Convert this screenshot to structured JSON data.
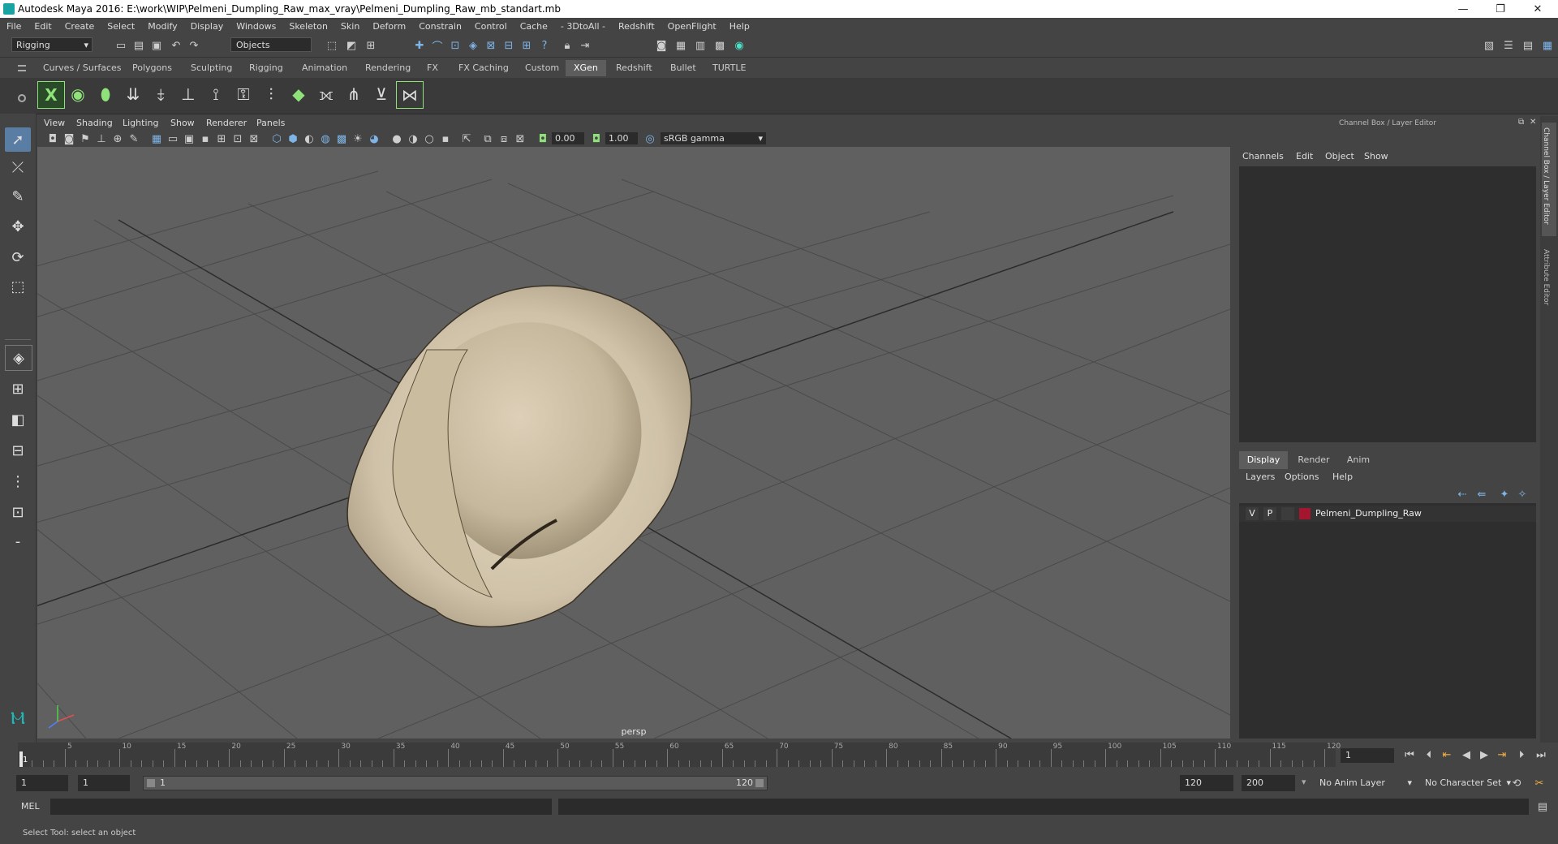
{
  "window": {
    "title": "Autodesk Maya 2016: E:\\work\\WIP\\Pelmeni_Dumpling_Raw_max_vray\\Pelmeni_Dumpling_Raw_mb_standart.mb",
    "minimize": "—",
    "restore": "❐",
    "close": "✕"
  },
  "menus": [
    "File",
    "Edit",
    "Create",
    "Select",
    "Modify",
    "Display",
    "Windows",
    "Skeleton",
    "Skin",
    "Deform",
    "Constrain",
    "Control",
    "Cache",
    "- 3DtoAll -",
    "Redshift",
    "OpenFlight",
    "Help"
  ],
  "statusline": {
    "mode": "Rigging",
    "objects": "Objects"
  },
  "shelf": {
    "tabs": [
      "Curves / Surfaces",
      "Polygons",
      "Sculpting",
      "Rigging",
      "Animation",
      "Rendering",
      "FX",
      "FX Caching",
      "Custom",
      "XGen",
      "Redshift",
      "Bullet",
      "TURTLE"
    ],
    "active": "XGen"
  },
  "panel": {
    "menus": [
      "View",
      "Shading",
      "Lighting",
      "Show",
      "Renderer",
      "Panels"
    ],
    "exposure": "0.00",
    "gamma": "1.00",
    "colorspace": "sRGB gamma",
    "camera": "persp"
  },
  "channelbox": {
    "title": "Channel Box / Layer Editor",
    "menus": [
      "Channels",
      "Edit",
      "Object",
      "Show"
    ]
  },
  "layer_editor": {
    "tabs": [
      "Display",
      "Render",
      "Anim"
    ],
    "active": "Display",
    "menus": [
      "Layers",
      "Options",
      "Help"
    ],
    "layers": [
      {
        "v": "V",
        "p": "P",
        "name": "Pelmeni_Dumpling_Raw",
        "color": "#a3162e"
      }
    ]
  },
  "side_tabs": [
    "Channel Box / Layer Editor",
    "Attribute Editor"
  ],
  "timeline": {
    "ticks": [
      "5",
      "10",
      "15",
      "20",
      "25",
      "30",
      "35",
      "40",
      "45",
      "50",
      "55",
      "60",
      "65",
      "70",
      "75",
      "80",
      "85",
      "90",
      "95",
      "100",
      "105",
      "110",
      "115",
      "120"
    ],
    "start_label": "1",
    "current_frame": "1"
  },
  "range": {
    "start": "1",
    "playback_start": "1",
    "slider_start": "1",
    "slider_end": "120",
    "playback_end": "120",
    "end": "200",
    "anim_layer": "No Anim Layer",
    "char_set": "No Character Set"
  },
  "cmdline": {
    "label": "MEL"
  },
  "helpline": {
    "text": "Select Tool: select an object"
  },
  "colors": {
    "accent": "#5a7da3",
    "shelf_icon": "#8fe27a",
    "dumpling": "#d2c6ae"
  }
}
